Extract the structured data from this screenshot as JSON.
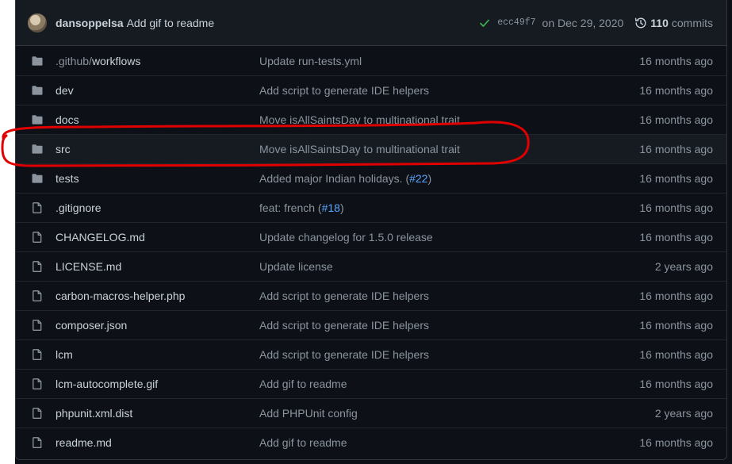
{
  "commit": {
    "author": "dansoppelsa",
    "message": "Add gif to readme",
    "sha": "ecc49f7",
    "date": "on Dec 29, 2020",
    "count": "110",
    "count_label": "commits",
    "status": "success"
  },
  "files": [
    {
      "type": "dir",
      "name_prefix": ".github/",
      "name": "workflows",
      "commit": "Update run-tests.yml",
      "issue": "",
      "age": "16 months ago"
    },
    {
      "type": "dir",
      "name_prefix": "",
      "name": "dev",
      "commit": "Add script to generate IDE helpers",
      "issue": "",
      "age": "16 months ago"
    },
    {
      "type": "dir",
      "name_prefix": "",
      "name": "docs",
      "commit": "Move isAllSaintsDay to multinational trait",
      "issue": "",
      "age": "16 months ago"
    },
    {
      "type": "dir",
      "name_prefix": "",
      "name": "src",
      "commit": "Move isAllSaintsDay to multinational trait",
      "issue": "",
      "age": "16 months ago"
    },
    {
      "type": "dir",
      "name_prefix": "",
      "name": "tests",
      "commit": "Added major Indian holidays. (",
      "issue": "#22",
      "commit_suffix": ")",
      "age": "16 months ago"
    },
    {
      "type": "file",
      "name_prefix": "",
      "name": ".gitignore",
      "commit": "feat: french (",
      "issue": "#18",
      "commit_suffix": ")",
      "age": "16 months ago"
    },
    {
      "type": "file",
      "name_prefix": "",
      "name": "CHANGELOG.md",
      "commit": "Update changelog for 1.5.0 release",
      "issue": "",
      "age": "16 months ago"
    },
    {
      "type": "file",
      "name_prefix": "",
      "name": "LICENSE.md",
      "commit": "Update license",
      "issue": "",
      "age": "2 years ago"
    },
    {
      "type": "file",
      "name_prefix": "",
      "name": "carbon-macros-helper.php",
      "commit": "Add script to generate IDE helpers",
      "issue": "",
      "age": "16 months ago"
    },
    {
      "type": "file",
      "name_prefix": "",
      "name": "composer.json",
      "commit": "Add script to generate IDE helpers",
      "issue": "",
      "age": "16 months ago"
    },
    {
      "type": "file",
      "name_prefix": "",
      "name": "lcm",
      "commit": "Add script to generate IDE helpers",
      "issue": "",
      "age": "16 months ago"
    },
    {
      "type": "file",
      "name_prefix": "",
      "name": "lcm-autocomplete.gif",
      "commit": "Add gif to readme",
      "issue": "",
      "age": "16 months ago"
    },
    {
      "type": "file",
      "name_prefix": "",
      "name": "phpunit.xml.dist",
      "commit": "Add PHPUnit config",
      "issue": "",
      "age": "2 years ago"
    },
    {
      "type": "file",
      "name_prefix": "",
      "name": "readme.md",
      "commit": "Add gif to readme",
      "issue": "",
      "age": "16 months ago"
    }
  ],
  "highlighted_row": "src",
  "colors": {
    "background": "#0d1117",
    "header": "#161b22",
    "border": "#30363d",
    "text": "#c9d1d9",
    "muted": "#8b949e",
    "link": "#58a6ff",
    "success": "#3fb950",
    "folder": "#8b949e",
    "annotation": "#e00000"
  },
  "icons": {
    "dir": "folder-icon",
    "file": "file-icon",
    "status": "check-icon",
    "history": "history-icon"
  }
}
